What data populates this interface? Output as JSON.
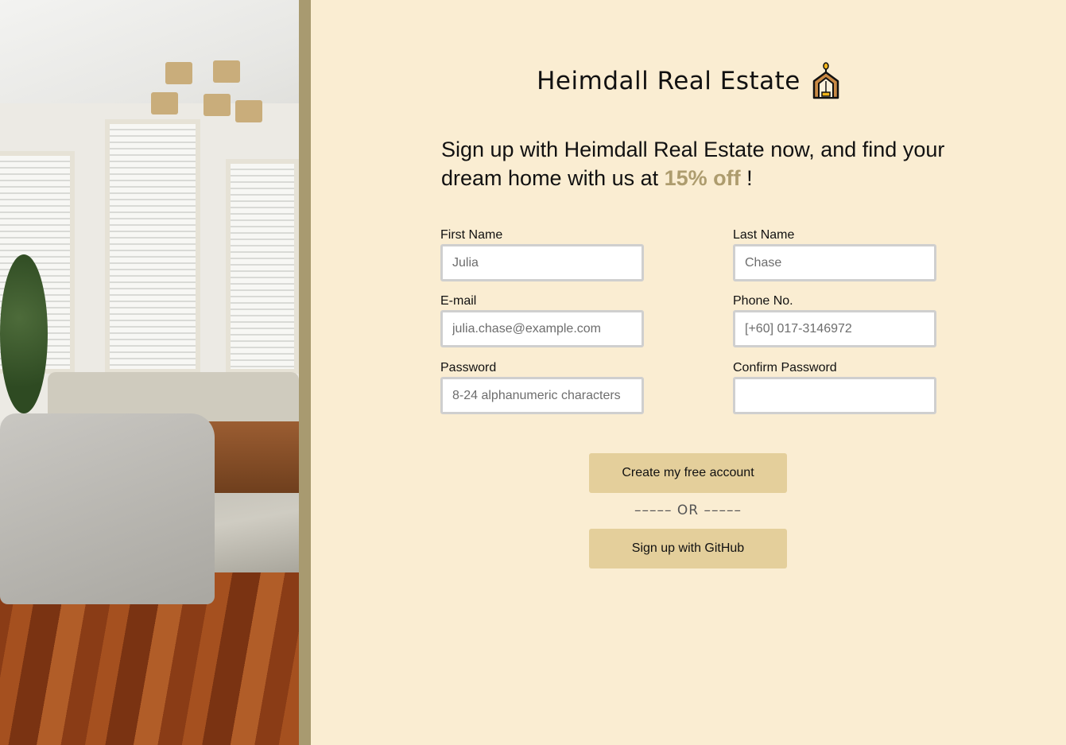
{
  "brand": {
    "title": "Heimdall Real Estate",
    "icon": "house-icon"
  },
  "headline": {
    "text_before": "Sign up with Heimdall Real Estate now, and find your dream home with us at ",
    "highlight": "15% off",
    "text_after": " !"
  },
  "form": {
    "first_name": {
      "label": "First Name",
      "placeholder": "Julia"
    },
    "last_name": {
      "label": "Last Name",
      "placeholder": "Chase"
    },
    "email": {
      "label": "E-mail",
      "placeholder": "julia.chase@example.com"
    },
    "phone": {
      "label": "Phone No.",
      "placeholder": "[+60] 017-3146972"
    },
    "password": {
      "label": "Password",
      "placeholder": "8-24 alphanumeric characters"
    },
    "confirm_password": {
      "label": "Confirm Password",
      "placeholder": ""
    }
  },
  "actions": {
    "create_label": "Create my free account",
    "or_label": "––––– OR –––––",
    "github_label": "Sign up with GitHub"
  },
  "colors": {
    "background": "#faedd2",
    "accent_bar": "#a89a70",
    "button": "#e4cf9b",
    "highlight": "#ad9c6e"
  }
}
